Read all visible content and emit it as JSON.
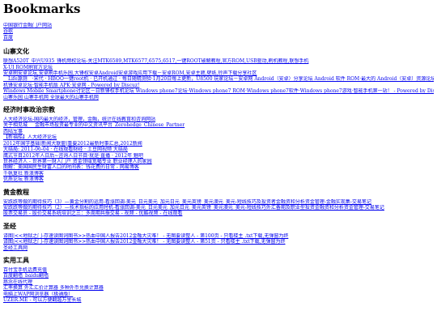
{
  "page": {
    "title": "Bookmarks"
  },
  "top_links": [
    "中国银行金融门户网站",
    "谷歌",
    "百度"
  ],
  "sections": [
    {
      "title": "山寨文化",
      "links": [
        "联想A520T_中兴U935_锋机频权论坛-关注MTK6589,MTK6577,6575,6517,一键ROOT破解教程,官方ROM,USB驱动,刷机教程,联想手机",
        "X-UI ROM刷官方论坛",
        "安卓刷安卓论坛,安卓刷手机乐园,大锋权安卓Android安卓游戏应用下载－安卓ROM,安卓主题,壁纸,铃声下载分享社区",
        "　Life源测　·宋代 · HBOO一键root机 · 已开机通过 · 每日随精测验·1月20日每上更新，U8500 玩家论坛－安卓网 Android（安卓）分享论坛 Android 软件 ROM·最大的 Android（安卓）资源论坛及 Powered by Discuz!",
        "机锋安卓论坛·智能手机版 APK·安卓网 - Powered by Discuz!",
        "Windows Mobile Smartphone讨论区－日新锋权手机论坛 Windows phone7论坛·Windows phone7 ROM·Windows phone7软件·Windows phone7游戏·智能手机第一站！ - Powered by Discuz!",
        "山寨乐园 山寨手机网 全球最大的山寨手机网"
      ]
    },
    {
      "title": "经济时事政治宗教",
      "links": [
        "人大经济论坛-国内最大的经济，管理，金融，统计在线教育和咨询网站",
        "关于相见城___金融市场投资最专业的中文资讯平台_Zerohedge_Chinese_Partner",
        "西陆军事",
        "【新福船】人大经济论坛",
        "2012年国学基础|新闻大联盟|重要2012最新时事汇总,2012新闻",
        "大结局: 2011-06-04 · 在线观看财经 · 土豆网视频 大结局",
        "鹰式节目2012年人日后~咨询人日节目·就是·直播 · 2012年 魅吧",
        "世界经济人 - 世界第一财人门户 资金领域宽幅专业 职业经理人的家园",
        "图解：美国国民生财富人口的时间表：钱花费的日常 - 网易博客",
        "千帆复社 新浪博客",
        "优质论坛 新浪博客"
      ]
    },
    {
      "title": "黄金教程",
      "links": [
        "安跌跌等做的期待技巧（3）—黄金分割的运用-看涨回调-美元_日元美元_加元日元_美元英镑_美元澳元_美元-短线技巧及投资者金融资和分析资金管理-金融实现集-交易笔记",
        "安跌跌等做的期待技巧（2）—技术指标的应用时机-看涨回调-美元_日元美元_加元日元_美元英镑_美元澳元_美元-短线技巧外汇备期及职业型投资金融资和分析资金管理-交易笔记",
        "股票交易员 - 股价交易系统培训之三：多周期共振交易 - 视频 - 优酷视频 - 在线观看"
      ]
    },
    {
      "title": "圣经",
      "links": [
        "译图|<<地狱之门-存速读图词图书>>热血中国人报告2012金融大灾难！ - 无图要读整人 - 第100页 - 只看楼主 .txt下载,无弹窗为终",
        "译图|<<地狱之门-存速读图词图书>>热血中国人报告2012金融大灾难！ - 无图要读整人 - 第51页 - 只看楼主 .txt下载,无弹窗为终",
        "圣经工具网"
      ]
    },
    {
      "title": "实用工具",
      "links": [
        "百付宝手机话费充值",
        "百度翻墙_baidu翻墙",
        "慈念在线代理",
        "汇率换算 外汇汇价计算器 多种外币兑换计算器",
        "电脑上WAP网浏览器（极通版）",
        "UZER.ME - 可以方便翻越万里长城"
      ]
    }
  ]
}
